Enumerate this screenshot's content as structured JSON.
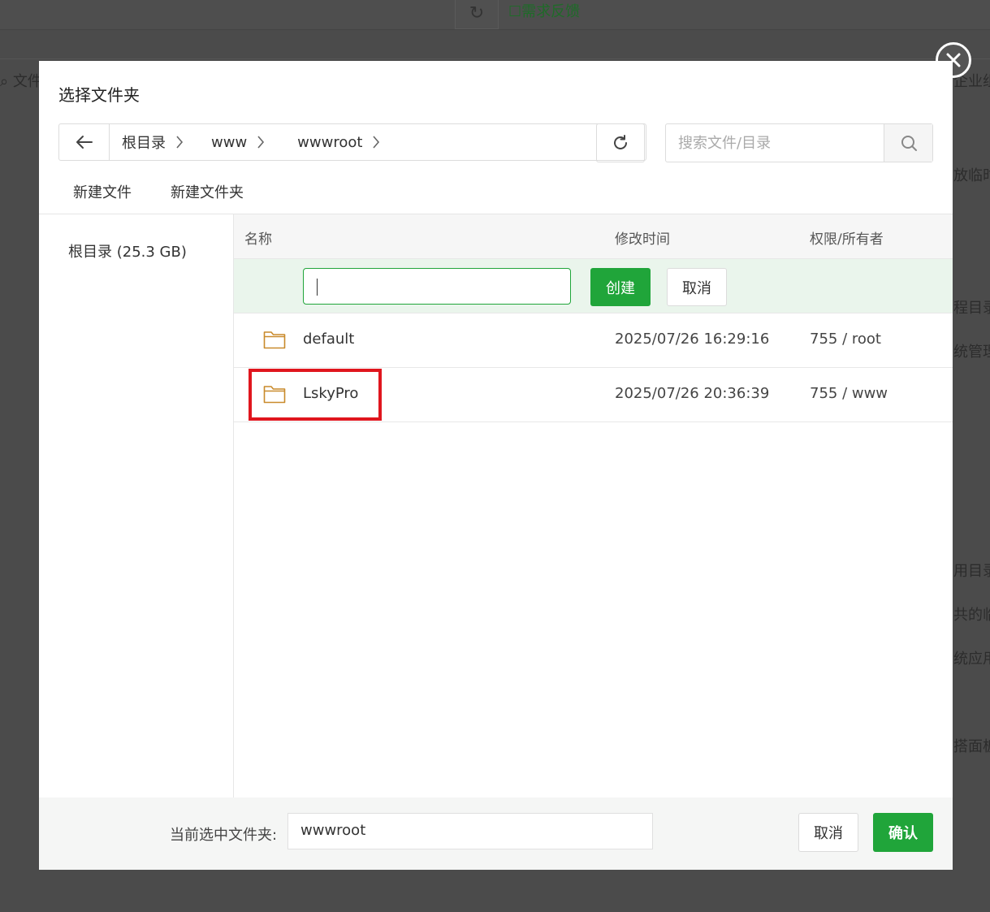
{
  "background": {
    "feedback_label": "需求反馈",
    "side_texts": [
      "文件",
      "企业组",
      "放临时",
      "程目录",
      "统管理",
      "用目录",
      "共的临",
      "统应用",
      "搭面板"
    ]
  },
  "dialog": {
    "title": "选择文件夹",
    "breadcrumb": [
      "根目录",
      "www",
      "wwwroot"
    ],
    "search_placeholder": "搜索文件/目录",
    "toolbar": {
      "new_file": "新建文件",
      "new_folder": "新建文件夹"
    },
    "sidebar": {
      "root_label": "根目录 (25.3 GB)"
    },
    "table": {
      "headers": {
        "name": "名称",
        "mtime": "修改时间",
        "perm": "权限/所有者"
      },
      "create_row": {
        "input_value": "",
        "create_label": "创建",
        "cancel_label": "取消"
      },
      "rows": [
        {
          "name": "default",
          "mtime": "2025/07/26 16:29:16",
          "perm": "755 / root"
        },
        {
          "name": "LskyPro",
          "mtime": "2025/07/26 20:36:39",
          "perm": "755 / www"
        }
      ]
    },
    "footer": {
      "current_label": "当前选中文件夹:",
      "current_value": "wwwroot",
      "cancel_label": "取消",
      "confirm_label": "确认"
    }
  },
  "colors": {
    "accent": "#20a53a",
    "highlight": "#e0161e",
    "folder": "#c98a2b"
  }
}
